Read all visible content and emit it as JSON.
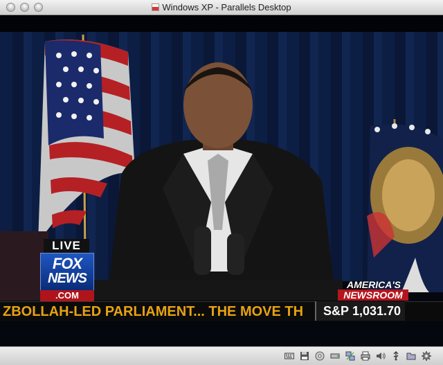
{
  "window": {
    "title": "Windows XP - Parallels Desktop"
  },
  "video": {
    "live_label": "LIVE",
    "network_line1": "FOX",
    "network_line2": "NEWS",
    "network_domain": ".COM",
    "show_line1": "AMERICA'S",
    "show_line2": "NEWSROOM",
    "ticker_text": "ZBOLLAH-LED PARLIAMENT... THE MOVE TH",
    "stock_label": "S&P",
    "stock_value": "1,031.70"
  },
  "statusbar": {
    "icons": [
      "keyboard-icon",
      "floppy-icon",
      "cd-icon",
      "hard-disk-icon",
      "network-icon",
      "printer-icon",
      "speaker-icon",
      "usb-icon",
      "shared-folder-icon",
      "gear-icon"
    ]
  },
  "colors": {
    "ticker": "#e8a312",
    "fox_blue": "#1f56c2",
    "fox_red": "#b0141b"
  }
}
